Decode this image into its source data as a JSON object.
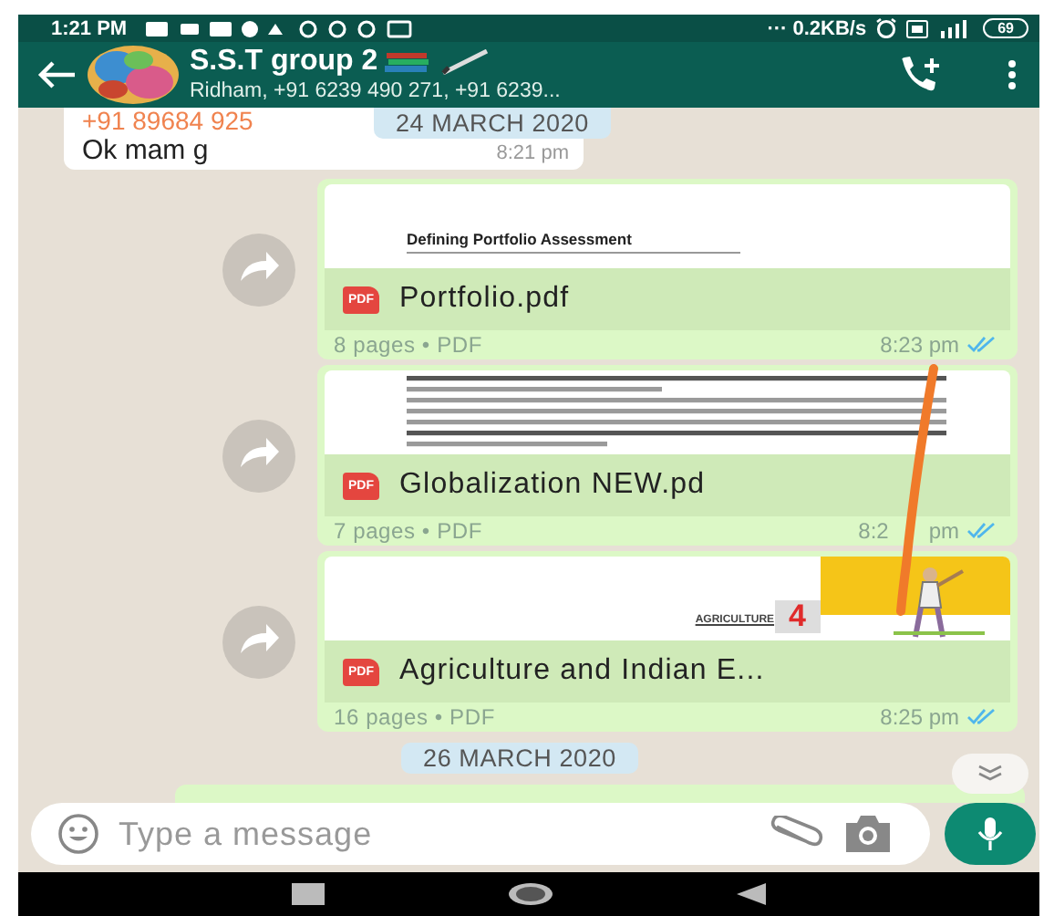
{
  "status_bar": {
    "time": "1:21 PM",
    "speed": "··· 0.2KB/s",
    "battery": "69"
  },
  "header": {
    "title": "S.S.T group 2",
    "subtitle": "Ridham, +91 6239 490 271, +91 6239..."
  },
  "incoming": {
    "sender": "+91 89684 925",
    "text": "Ok mam g",
    "time": "8:21 pm"
  },
  "date_chips": [
    "24 MARCH 2020",
    "26 MARCH 2020"
  ],
  "documents": [
    {
      "preview": {
        "kind": "heading",
        "text": "Defining Portfolio Assessment"
      },
      "file_name": "Portfolio.pdf",
      "file_type": "PDF",
      "info": "8 pages • PDF",
      "time": "8:23 pm",
      "read": true
    },
    {
      "preview": {
        "kind": "text_page"
      },
      "file_name": "Globalization NEW.pd",
      "file_type": "PDF",
      "info": "7 pages • PDF",
      "time": "8:2",
      "time_tail": "pm",
      "read": true
    },
    {
      "preview": {
        "kind": "cover",
        "label": "AGRICULTURE",
        "number": "4"
      },
      "file_name": "Agriculture and Indian E...",
      "file_type": "PDF",
      "info": "16 pages • PDF",
      "time": "8:25 pm",
      "read": true
    }
  ],
  "composer": {
    "placeholder": "Type a message"
  }
}
